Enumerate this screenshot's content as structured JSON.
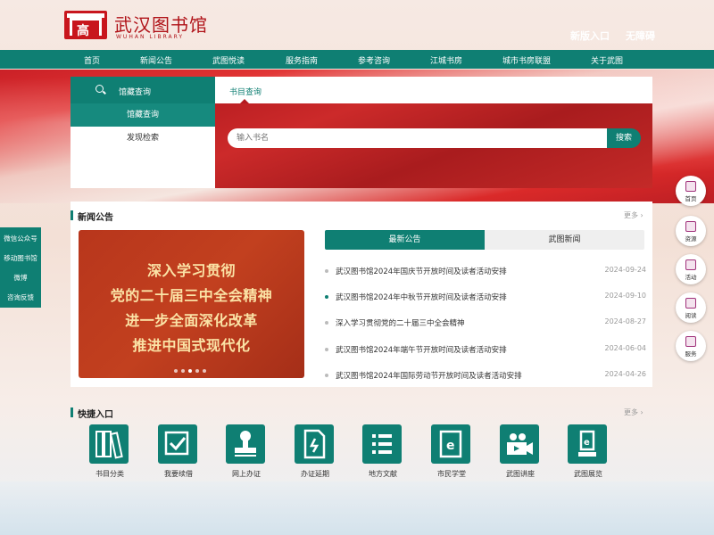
{
  "header": {
    "logo_text": "武汉图书馆",
    "logo_sub": "WUHAN LIBRARY",
    "logo_char": "高",
    "new_entry": "新版入口",
    "accessibility": "无障碍"
  },
  "nav": [
    "首页",
    "新闻公告",
    "武图悦读",
    "服务指南",
    "参考咨询",
    "江城书房",
    "城市书房联盟",
    "关于武图"
  ],
  "search": {
    "left_title": "馆藏查询",
    "left_items": [
      "馆藏查询",
      "发现检索"
    ],
    "tab": "书目查询",
    "placeholder": "输入书名",
    "button": "搜索"
  },
  "news": {
    "title": "新闻公告",
    "more": "更多 ›",
    "banner_lines": [
      "深入学习贯彻",
      "党的二十届三中全会精神",
      "进一步全面深化改革",
      "推进中国式现代化"
    ],
    "tabs": [
      "最新公告",
      "武图新闻"
    ],
    "items": [
      {
        "title": "武汉图书馆2024年国庆节开放时间及读者活动安排",
        "date": "2024-09-24",
        "highlight": false
      },
      {
        "title": "武汉图书馆2024年中秋节开放时间及读者活动安排",
        "date": "2024-09-10",
        "highlight": true
      },
      {
        "title": "深入学习贯彻党的二十届三中全会精神",
        "date": "2024-08-27",
        "highlight": false
      },
      {
        "title": "武汉图书馆2024年端午节开放时间及读者活动安排",
        "date": "2024-06-04",
        "highlight": false
      },
      {
        "title": "武汉图书馆2024年国际劳动节开放时间及读者活动安排",
        "date": "2024-04-26",
        "highlight": false
      }
    ]
  },
  "quick": {
    "title": "快捷入口",
    "more": "更多 ›",
    "items": [
      {
        "label": "书目分类",
        "icon": "books-icon"
      },
      {
        "label": "我要续借",
        "icon": "check-icon"
      },
      {
        "label": "网上办证",
        "icon": "stamp-icon"
      },
      {
        "label": "办证延期",
        "icon": "document-icon"
      },
      {
        "label": "地方文献",
        "icon": "list-icon"
      },
      {
        "label": "市民学堂",
        "icon": "ebook-icon"
      },
      {
        "label": "武图讲座",
        "icon": "video-icon"
      },
      {
        "label": "武图展览",
        "icon": "exhibit-icon"
      }
    ]
  },
  "left_float": [
    "微信公众号",
    "移动图书馆",
    "微博",
    "咨询反馈"
  ],
  "right_float": [
    "首页",
    "资源",
    "活动",
    "阅读",
    "服务"
  ],
  "colors": {
    "primary": "#0f7f73",
    "brand_red": "#c8161d"
  }
}
